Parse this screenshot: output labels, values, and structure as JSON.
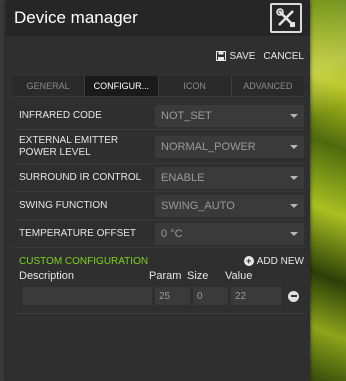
{
  "window": {
    "title": "Device manager"
  },
  "actions": {
    "save": "SAVE",
    "cancel": "CANCEL"
  },
  "tabs": [
    {
      "label": "GENERAL",
      "active": false
    },
    {
      "label": "CONFIGUR...",
      "active": true
    },
    {
      "label": "ICON",
      "active": false
    },
    {
      "label": "ADVANCED",
      "active": false
    }
  ],
  "fields": [
    {
      "label": "INFRARED CODE",
      "value": "NOT_SET"
    },
    {
      "label": "EXTERNAL EMITTER POWER LEVEL",
      "value": "NORMAL_POWER"
    },
    {
      "label": "SURROUND IR CONTROL",
      "value": "ENABLE"
    },
    {
      "label": "SWING FUNCTION",
      "value": "SWING_AUTO"
    },
    {
      "label": "TEMPERATURE OFFSET",
      "value": "0 °C"
    }
  ],
  "custom": {
    "title": "CUSTOM CONFIGURATION",
    "add_new": "ADD NEW",
    "columns": {
      "description": "Description",
      "param": "Param",
      "size": "Size",
      "value": "Value"
    },
    "rows": [
      {
        "description": "",
        "param": "25",
        "size": "0",
        "value": "22"
      }
    ]
  },
  "colors": {
    "accent_green": "#7ed321",
    "panel_bg": "#2f2f2f"
  },
  "icons": {
    "logo": "tools-cross-icon",
    "save": "floppy-disk-icon",
    "add": "plus-circle-icon",
    "remove": "minus-circle-icon",
    "dropdown": "caret-down-icon"
  }
}
